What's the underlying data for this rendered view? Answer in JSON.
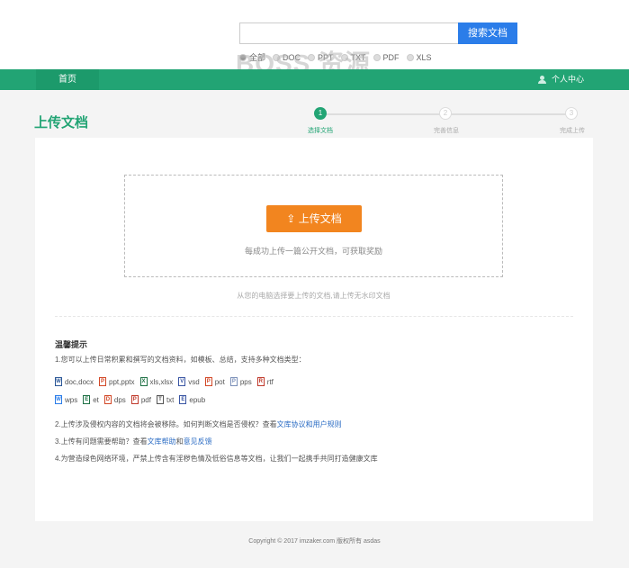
{
  "search": {
    "button_label": "搜索文档",
    "placeholder": "",
    "types": [
      {
        "label": "全部",
        "selected": true
      },
      {
        "label": "DOC",
        "selected": false
      },
      {
        "label": "PPT",
        "selected": false
      },
      {
        "label": "TXT",
        "selected": false
      },
      {
        "label": "PDF",
        "selected": false
      },
      {
        "label": "XLS",
        "selected": false
      }
    ]
  },
  "watermark": "BOSS 资源",
  "nav": {
    "home": "首页",
    "user_center": "个人中心"
  },
  "page": {
    "title": "上传文档"
  },
  "steps": [
    {
      "num": "1",
      "label": "选择文档",
      "active": true
    },
    {
      "num": "2",
      "label": "完善信息",
      "active": false
    },
    {
      "num": "3",
      "label": "完成上传",
      "active": false
    }
  ],
  "upload": {
    "button_label": "上传文档",
    "hint": "每成功上传一篇公开文档，可获取奖励",
    "subhint": "从您的电脑选择要上传的文档,请上传无水印文档"
  },
  "tips": {
    "title": "温馨提示",
    "line1": "1.您可以上传日常积累和撰写的文档资料，如模板、总结，支持多种文档类型：",
    "file_types_row1": [
      {
        "label": "doc,docx",
        "icon": "W",
        "color": "#2b5797"
      },
      {
        "label": "ppt,pptx",
        "icon": "P",
        "color": "#d24726"
      },
      {
        "label": "xls,xlsx",
        "icon": "X",
        "color": "#1e7145"
      },
      {
        "label": "vsd",
        "icon": "V",
        "color": "#3955a3"
      },
      {
        "label": "pot",
        "icon": "P",
        "color": "#d24726"
      },
      {
        "label": "pps",
        "icon": "P",
        "color": "#7a8fb8"
      },
      {
        "label": "rtf",
        "icon": "R",
        "color": "#c0392b"
      }
    ],
    "file_types_row2": [
      {
        "label": "wps",
        "icon": "W",
        "color": "#2b7de9"
      },
      {
        "label": "et",
        "icon": "E",
        "color": "#1e7145"
      },
      {
        "label": "dps",
        "icon": "D",
        "color": "#d24726"
      },
      {
        "label": "pdf",
        "icon": "P",
        "color": "#c0392b"
      },
      {
        "label": "txt",
        "icon": "T",
        "color": "#555555"
      },
      {
        "label": "epub",
        "icon": "E",
        "color": "#3955a3"
      }
    ],
    "line2_prefix": "2.上传涉及侵权内容的文档将会被移除。如何判断文档是否侵权？查看",
    "line2_link": "文库协议和用户规则",
    "line3_prefix": "3.上传有问题需要帮助？查看",
    "line3_link1": "文库帮助",
    "line3_mid": "和",
    "line3_link2": "意见反馈",
    "line4": "4.为营造绿色网络环境，严禁上传含有淫秽色情及低俗信息等文档，让我们一起携手共同打造健康文库"
  },
  "footer": "Copyright © 2017 imzaker.com 版权所有 asdas",
  "colors": {
    "brand": "#22a474",
    "accent": "#f2851f",
    "search": "#2b7de9"
  }
}
